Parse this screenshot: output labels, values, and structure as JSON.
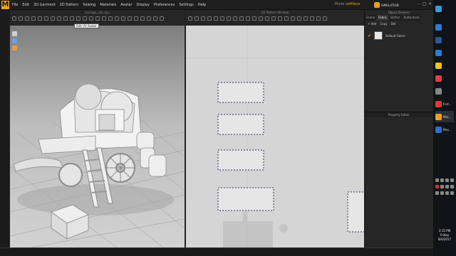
{
  "app": {
    "menu": [
      "File",
      "Edit",
      "3D Garment",
      "2D Pattern",
      "Sewing",
      "Materials",
      "Avatar",
      "Display",
      "Preferences",
      "Settings",
      "Help"
    ],
    "mode_label": "Mode",
    "mode_value": "softface",
    "simulation_label": "SIMULATION"
  },
  "window3d": {
    "title": "carriage_3ds_zprj",
    "tooltip": "Edit UV Avatar"
  },
  "window2d": {
    "title": "2D Pattern Window"
  },
  "right_panel": {
    "title": "Object Browser",
    "tabs": [
      "Scene",
      "Fabric",
      "Button",
      "Buttonhole"
    ],
    "actions": [
      "+ Add",
      "Copy",
      "Del"
    ],
    "fabric_item": "Default Fabric",
    "property_editor": "Property Editor"
  },
  "taskbar": {
    "apps": [
      {
        "label": "Fort...",
        "color": "#e23b2e"
      },
      {
        "label": "Mar...",
        "color": "#f0a020"
      },
      {
        "label": "Mes...",
        "color": "#2b6fd6"
      }
    ],
    "time": "2:15 PM",
    "day": "Friday",
    "date": "8/4/2017"
  }
}
